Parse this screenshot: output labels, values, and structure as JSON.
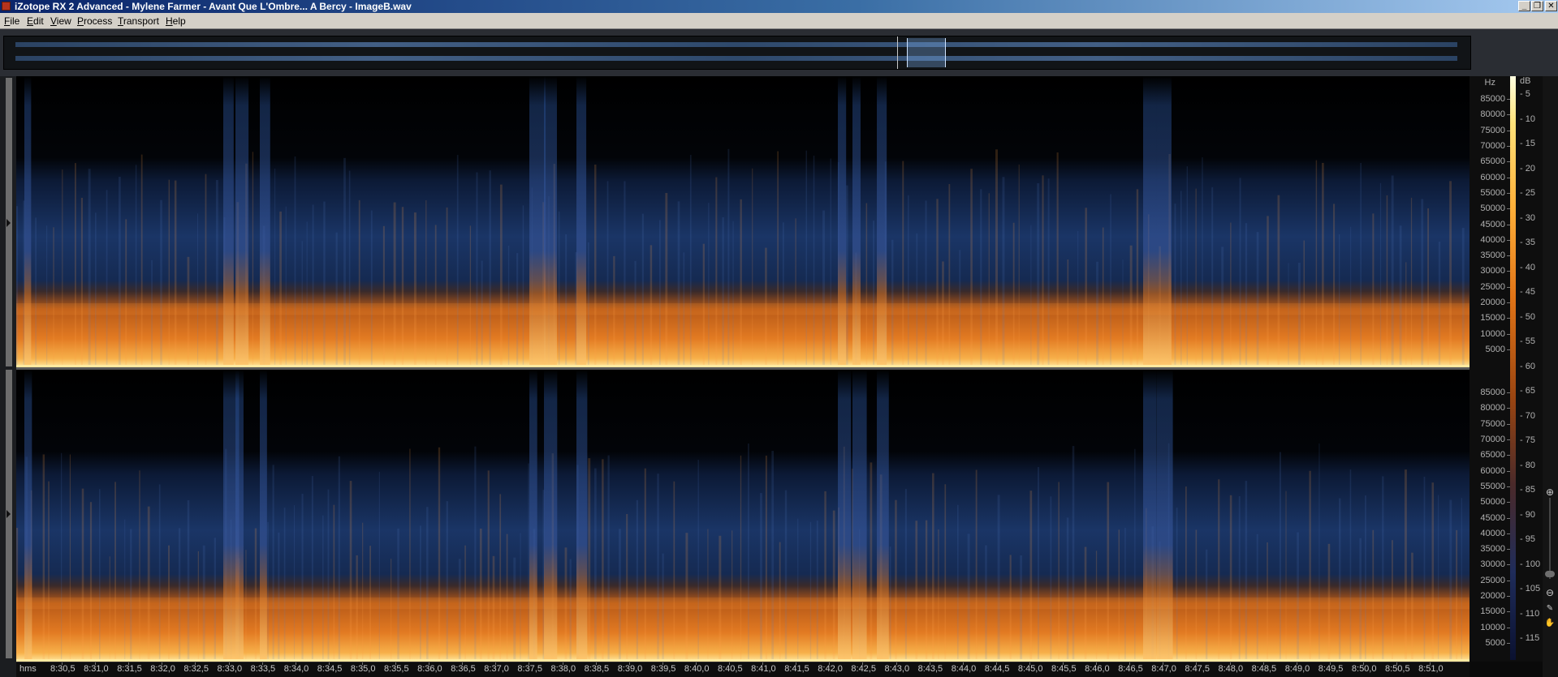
{
  "window": {
    "title": "iZotope RX 2 Advanced - Mylene Farmer - Avant Que L'Ombre... A Bercy - ImageB.wav",
    "controls": [
      "minimize-icon",
      "restore-icon",
      "close-icon"
    ]
  },
  "menu": {
    "items": [
      {
        "label": "File"
      },
      {
        "label": "Edit"
      },
      {
        "label": "View"
      },
      {
        "label": "Process"
      },
      {
        "label": "Transport"
      },
      {
        "label": "Help"
      }
    ]
  },
  "frequency_axis": {
    "unit": "Hz",
    "labels": [
      "85000",
      "80000",
      "75000",
      "70000",
      "65000",
      "60000",
      "55000",
      "50000",
      "45000",
      "40000",
      "35000",
      "30000",
      "25000",
      "20000",
      "15000",
      "10000",
      "5000"
    ]
  },
  "db_axis": {
    "unit": "dB",
    "labels": [
      "5",
      "10",
      "15",
      "20",
      "25",
      "30",
      "35",
      "40",
      "45",
      "50",
      "55",
      "60",
      "65",
      "70",
      "75",
      "80",
      "85",
      "90",
      "95",
      "100",
      "105",
      "110",
      "115"
    ]
  },
  "time_axis": {
    "unit": "hms",
    "labels": [
      "8:30,5",
      "8:31,0",
      "8:31,5",
      "8:32,0",
      "8:32,5",
      "8:33,0",
      "8:33,5",
      "8:34,0",
      "8:34,5",
      "8:35,0",
      "8:35,5",
      "8:36,0",
      "8:36,5",
      "8:37,0",
      "8:37,5",
      "8:38,0",
      "8:38,5",
      "8:39,0",
      "8:39,5",
      "8:40,0",
      "8:40,5",
      "8:41,0",
      "8:41,5",
      "8:42,0",
      "8:42,5",
      "8:43,0",
      "8:43,5",
      "8:44,0",
      "8:44,5",
      "8:45,0",
      "8:45,5",
      "8:46,0",
      "8:46,5",
      "8:47,0",
      "8:47,5",
      "8:48,0",
      "8:48,5",
      "8:49,0",
      "8:49,5",
      "8:50,0",
      "8:50,5",
      "8:51,0"
    ]
  },
  "colors": {
    "spectrogram_low": "#000000",
    "spectrogram_mid": "#1c3a6e",
    "spectrogram_high": "#f08a2a",
    "spectrogram_peak": "#ffe9a0",
    "accent": "#3a6ea5"
  },
  "icons": {
    "zoom_in": "zoom-in-icon",
    "zoom_out": "zoom-out-icon"
  }
}
